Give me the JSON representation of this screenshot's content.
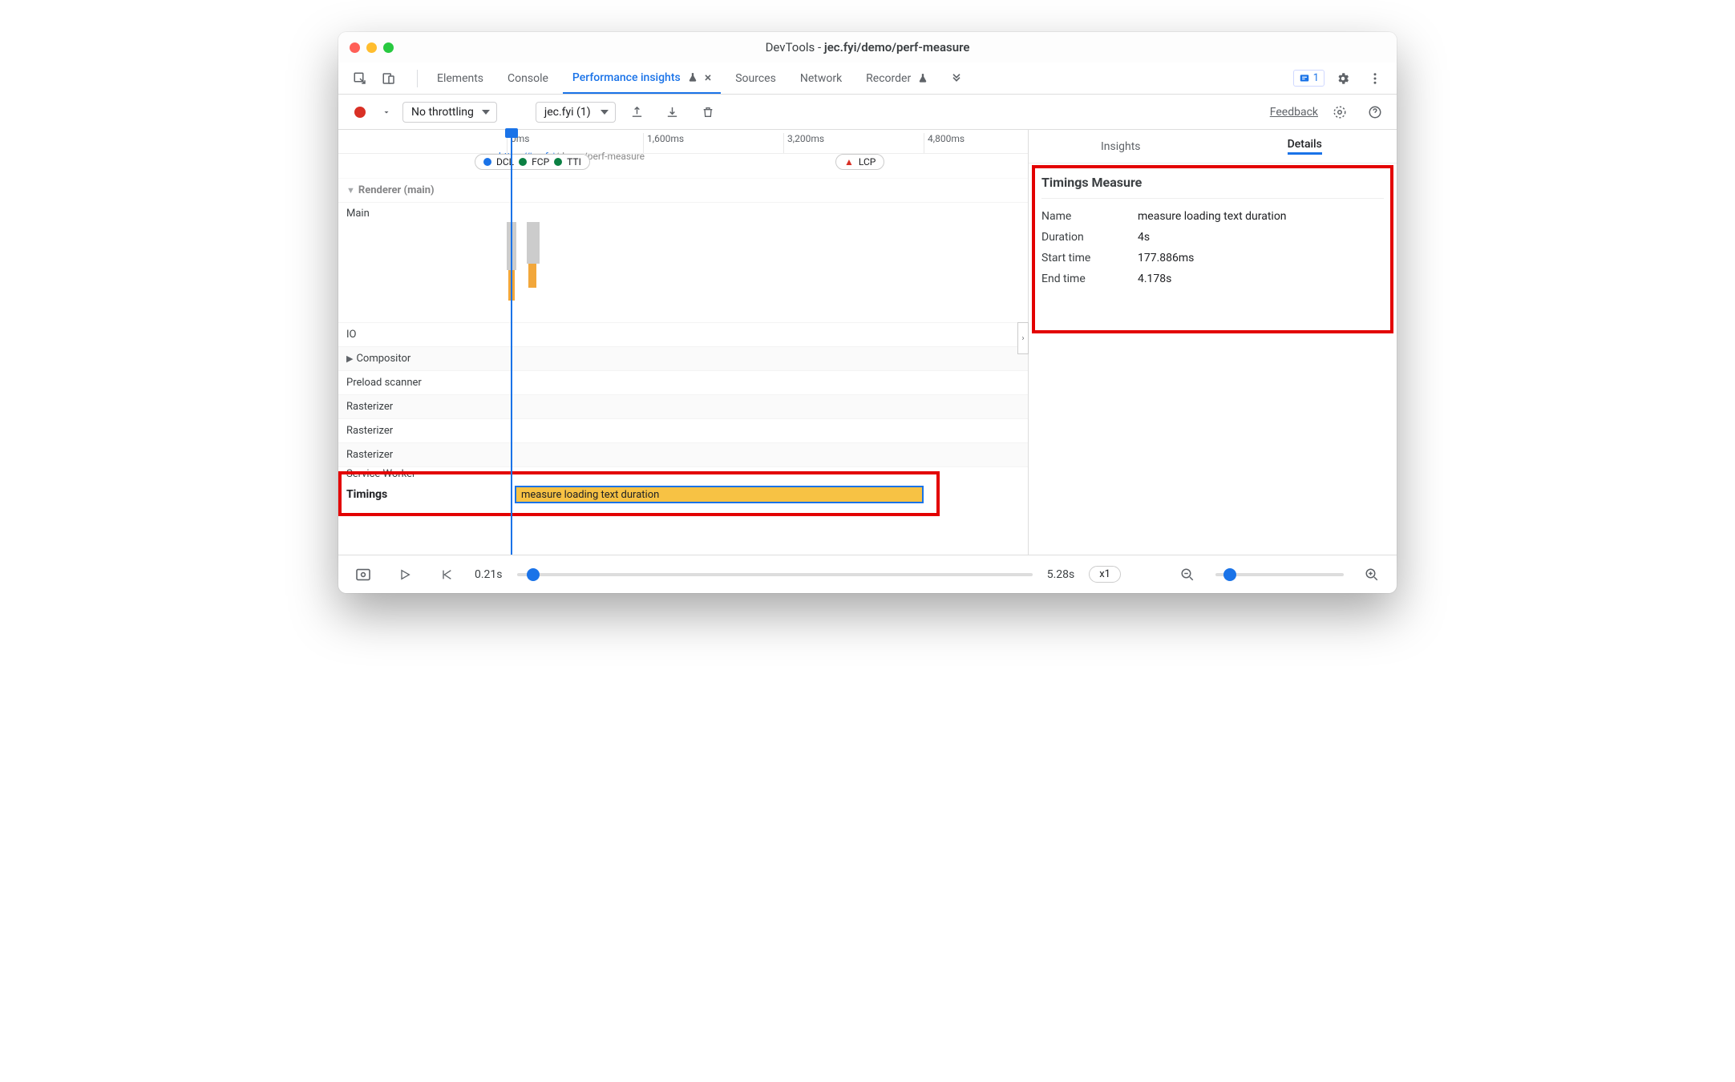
{
  "window": {
    "title_prefix": "DevTools - ",
    "title_url": "jec.fyi/demo/perf-measure"
  },
  "tabs": {
    "elements": "Elements",
    "console": "Console",
    "perf_insights": "Performance insights",
    "sources": "Sources",
    "network": "Network",
    "recorder": "Recorder",
    "issues_count": "1"
  },
  "toolbar": {
    "throttling": "No throttling",
    "recording": "jec.fyi (1)",
    "feedback": "Feedback"
  },
  "axis": {
    "tick0": "0ms",
    "tick1": "1,600ms",
    "tick2": "3,200ms",
    "tick3": "4,800ms"
  },
  "markers": {
    "dcl": "DCL",
    "fcp": "FCP",
    "tti": "TTI",
    "lcp": "LCP"
  },
  "url_strip": {
    "pre": "https://jec.fyi",
    "rest": "/demo/perf-measure"
  },
  "tracks": {
    "renderer": "Renderer (main)",
    "main": "Main",
    "io": "IO",
    "compositor": "Compositor",
    "preload": "Preload scanner",
    "raster1": "Rasterizer",
    "raster2": "Rasterizer",
    "raster3": "Rasterizer",
    "service_worker": "Service Worker",
    "timings": "Timings"
  },
  "measure_bar_label": "measure loading text duration",
  "side": {
    "tab_insights": "Insights",
    "tab_details": "Details",
    "heading": "Timings Measure",
    "rows": {
      "name_k": "Name",
      "name_v": "measure loading text duration",
      "dur_k": "Duration",
      "dur_v": "4s",
      "start_k": "Start time",
      "start_v": "177.886ms",
      "end_k": "End time",
      "end_v": "4.178s"
    }
  },
  "footer": {
    "from": "0.21s",
    "to": "5.28s",
    "speed": "x1"
  }
}
